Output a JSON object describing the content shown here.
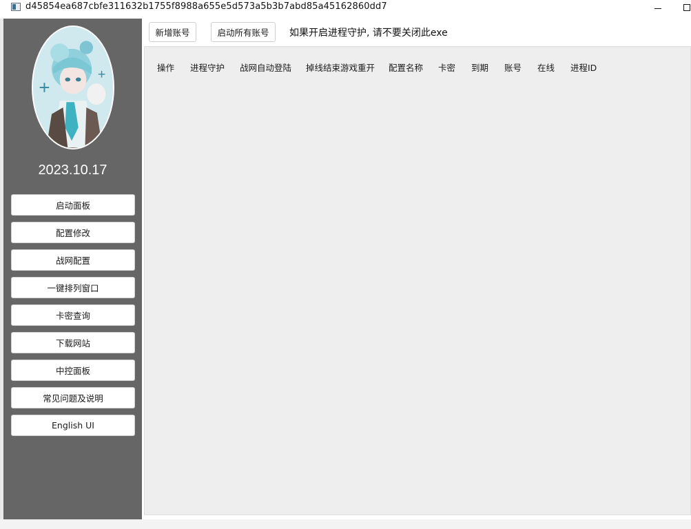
{
  "window": {
    "title": "d45854ea687cbfe311632b1755f8988a655e5d573a5b3b7abd85a45162860dd7",
    "icon": "app-window-icon"
  },
  "sidebar": {
    "date": "2023.10.17",
    "avatar": "anime-character-avatar",
    "buttons": [
      {
        "label": "启动面板"
      },
      {
        "label": "配置修改"
      },
      {
        "label": "战网配置"
      },
      {
        "label": "一键排列窗口"
      },
      {
        "label": "卡密查询"
      },
      {
        "label": "下载网站"
      },
      {
        "label": "中控面板"
      },
      {
        "label": "常见问题及说明"
      },
      {
        "label": "English UI"
      }
    ]
  },
  "toolbar": {
    "add_account": "新增账号",
    "start_all": "启动所有账号",
    "notice": "如果开启进程守护, 请不要关闭此exe"
  },
  "table": {
    "columns": [
      "操作",
      "进程守护",
      "战网自动登陆",
      "掉线结束游戏重开",
      "配置名称",
      "卡密",
      "到期",
      "账号",
      "在线",
      "进程ID"
    ],
    "rows": []
  }
}
